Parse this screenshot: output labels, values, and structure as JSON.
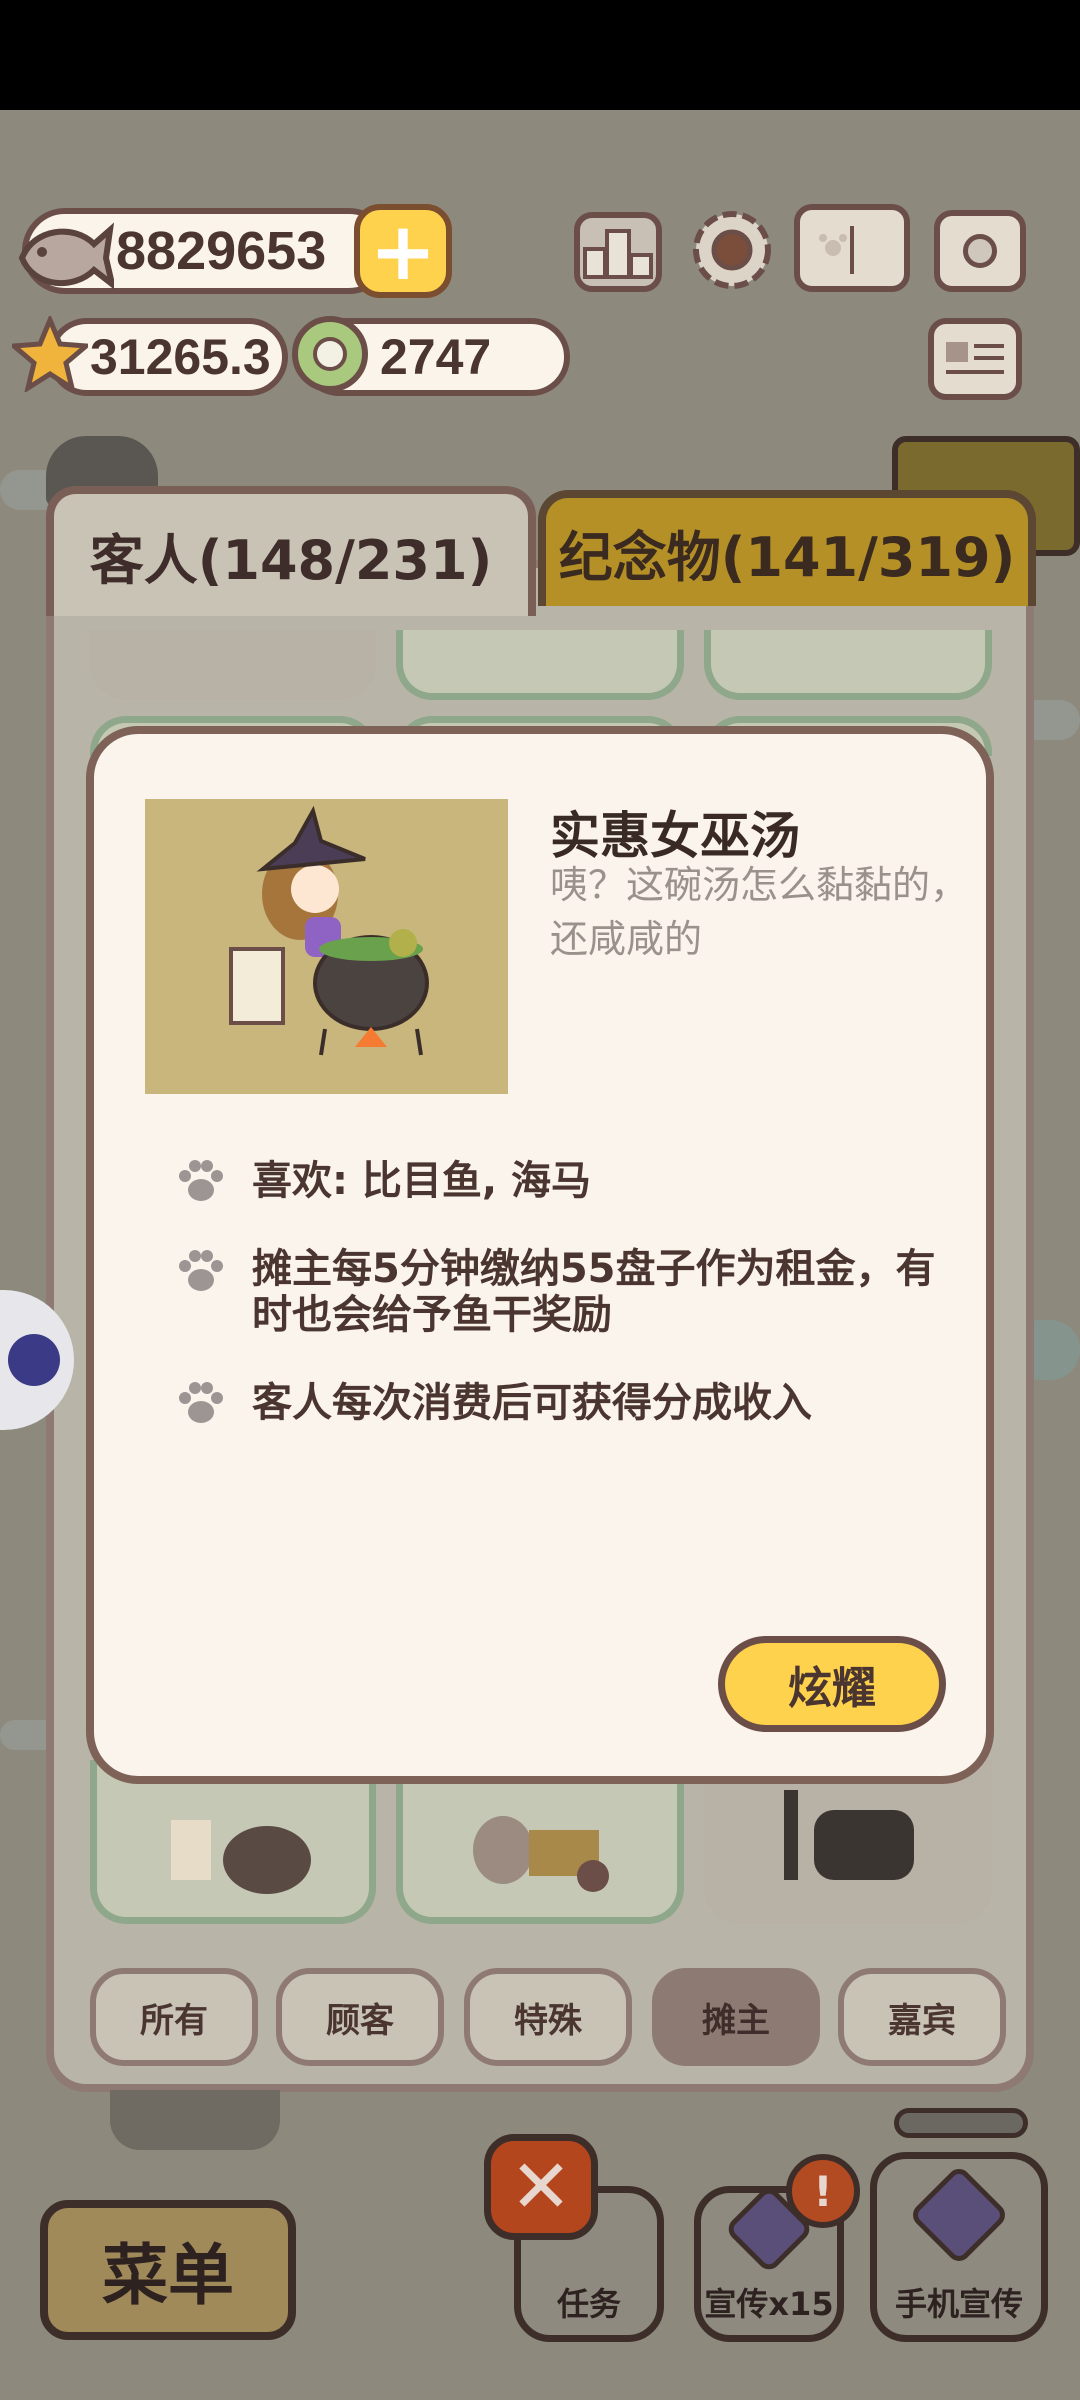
{
  "currency": {
    "fish": "8829653",
    "stars": "31265.3",
    "plates": "2747"
  },
  "hud_icons": [
    "plus-icon",
    "podium-icon",
    "gear-icon",
    "paw-book-icon",
    "camera-icon",
    "newspaper-icon"
  ],
  "tabs": {
    "guests": "客人(148/231)",
    "souvenirs": "纪念物(141/319)"
  },
  "modal": {
    "title": "实惠女巫汤",
    "description": "咦？这碗汤怎么黏黏的，还咸咸的",
    "bullets": [
      "喜欢: 比目鱼, 海马",
      "摊主每5分钟缴纳55盘子作为租金，有时也会给予鱼干奖励",
      "客人每次消费后可获得分成收入"
    ],
    "share_button": "炫耀"
  },
  "filters": [
    "所有",
    "顾客",
    "特殊",
    "摊主",
    "嘉宾"
  ],
  "active_filter": "摊主",
  "bottom_bar": {
    "menu": "菜单",
    "tasks": "任务",
    "promote": "宣传x15",
    "phone_promote": "手机宣传",
    "badge": "!"
  },
  "colors": {
    "accent_yellow": "#ffd24d",
    "outline_brown": "#6b4e47",
    "cream": "#fbf4ec",
    "close_red": "#b4461e"
  }
}
